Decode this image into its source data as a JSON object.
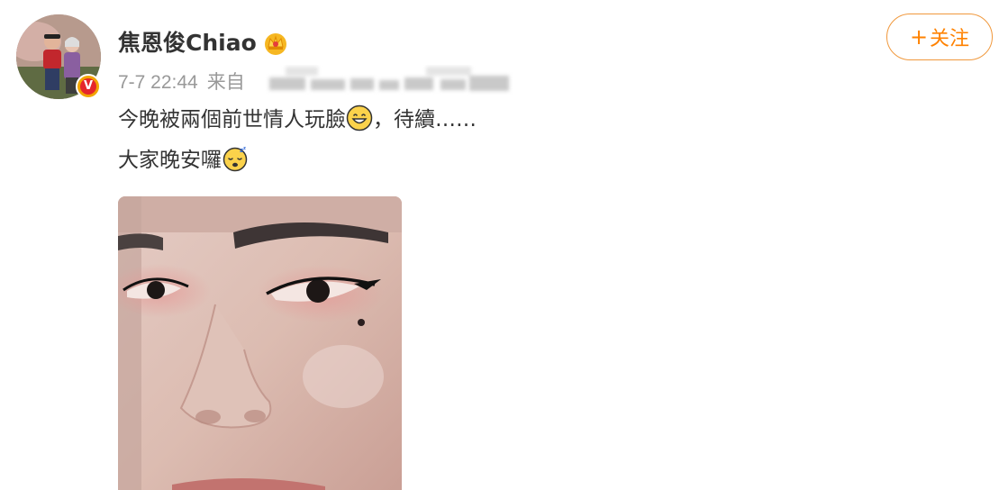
{
  "user": {
    "name": "焦恩俊Chiao",
    "verified_badge": "V"
  },
  "meta": {
    "time": "7-7 22:44",
    "source_label": "来自"
  },
  "follow": {
    "plus": "+",
    "label": "关注"
  },
  "post": {
    "line1_text": "今晚被兩個前世情人玩臉",
    "line1_suffix": "，待續……",
    "line1_emoji": "grinning-emoji",
    "line2_text": "大家晚安囉",
    "line2_emoji": "sleeping-emoji"
  },
  "colors": {
    "accent": "#ff8200",
    "verified": "#f2a400",
    "text": "#333333",
    "muted": "#999999"
  }
}
